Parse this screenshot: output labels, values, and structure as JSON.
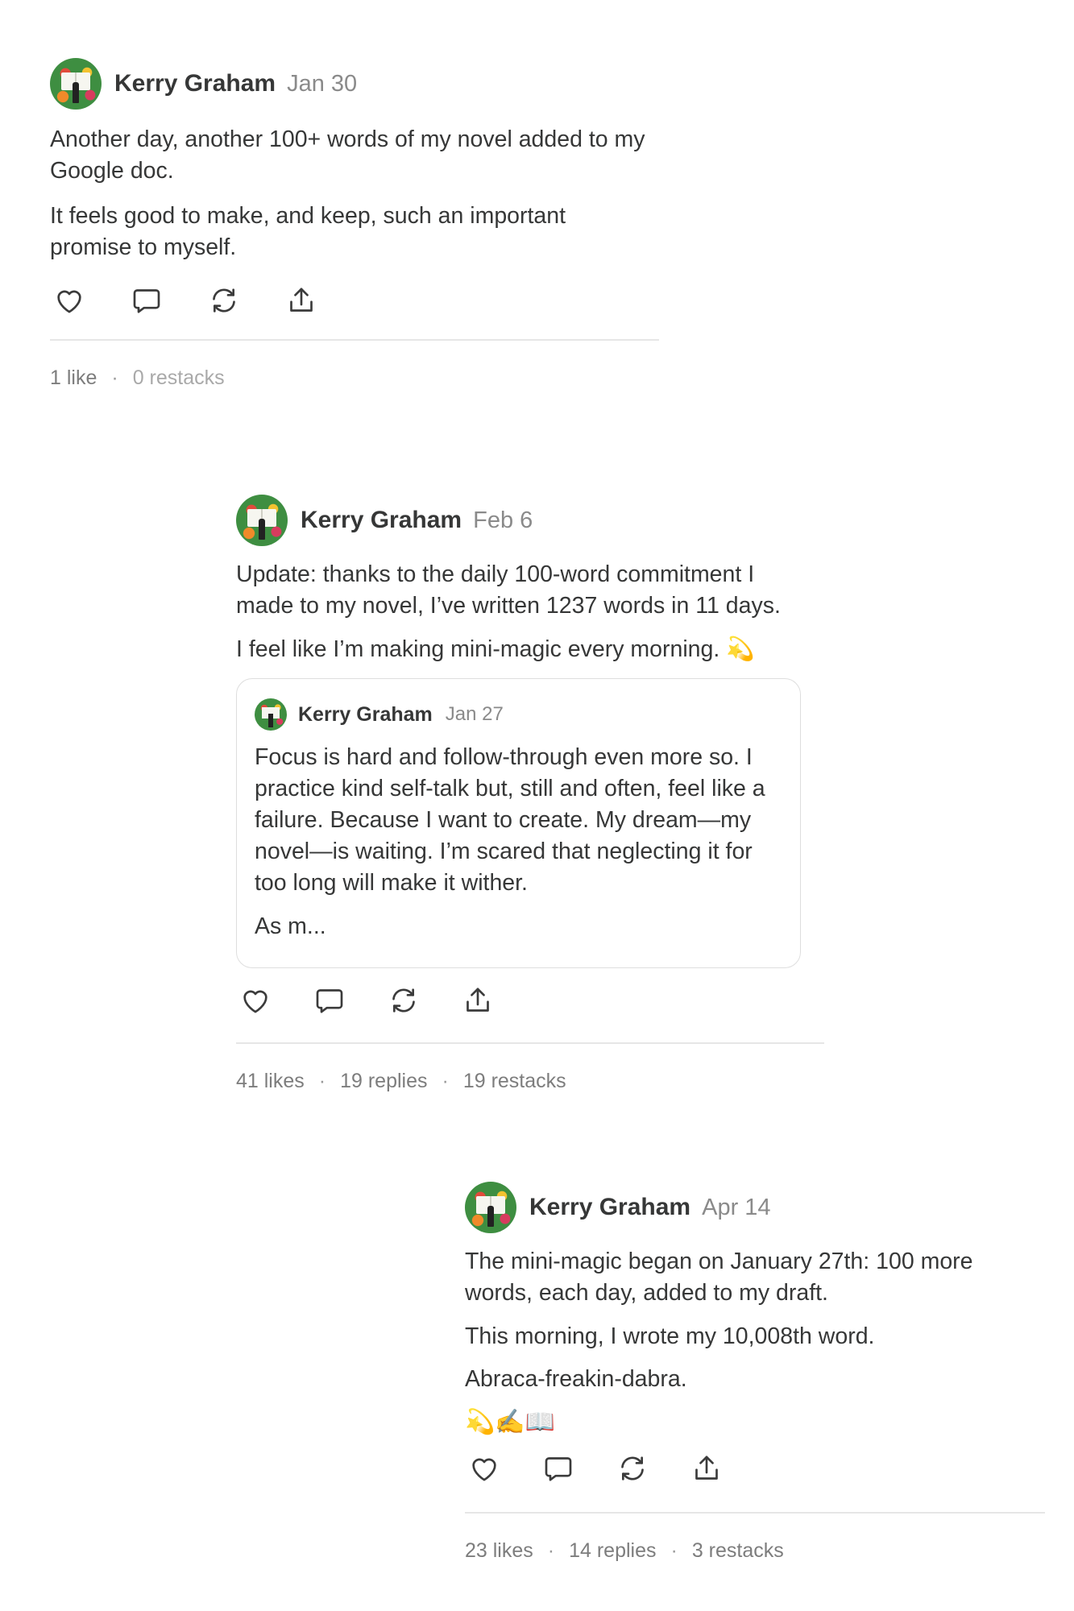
{
  "notes": [
    {
      "author": "Kerry Graham",
      "date": "Jan 30",
      "paragraphs": [
        "Another day, another 100+ words of my novel added to my Google doc.",
        "It feels good to make, and keep, such an important promise to myself."
      ],
      "stats": {
        "likes": "1 like",
        "restacks": "0 restacks"
      }
    },
    {
      "author": "Kerry Graham",
      "date": "Feb 6",
      "paragraphs": [
        "Update: thanks to the daily 100-word commitment I made to my novel, I’ve written 1237 words in 11 days.",
        "I feel like I’m making mini-magic every morning. 💫"
      ],
      "quoted": {
        "author": "Kerry Graham",
        "date": "Jan 27",
        "paragraphs": [
          "Focus is hard and follow-through even more so. I practice kind self-talk but, still and often, feel like a failure. Because I want to create. My dream—my novel—is waiting. I’m scared that neglecting it for too long will make it wither.",
          "As m..."
        ]
      },
      "stats": {
        "likes": "41 likes",
        "replies": "19 replies",
        "restacks": "19 restacks"
      }
    },
    {
      "author": "Kerry Graham",
      "date": "Apr 14",
      "paragraphs": [
        "The mini-magic began on January 27th: 100 more words, each day, added to my draft.",
        "This morning, I wrote my 10,008th word.",
        "Abraca-freakin-dabra.",
        "💫✍️📖"
      ],
      "stats": {
        "likes": "23 likes",
        "replies": "14 replies",
        "restacks": "3 restacks"
      }
    }
  ],
  "icons": [
    "heart-icon",
    "comment-icon",
    "restack-icon",
    "share-icon"
  ],
  "stat_separator": "·"
}
